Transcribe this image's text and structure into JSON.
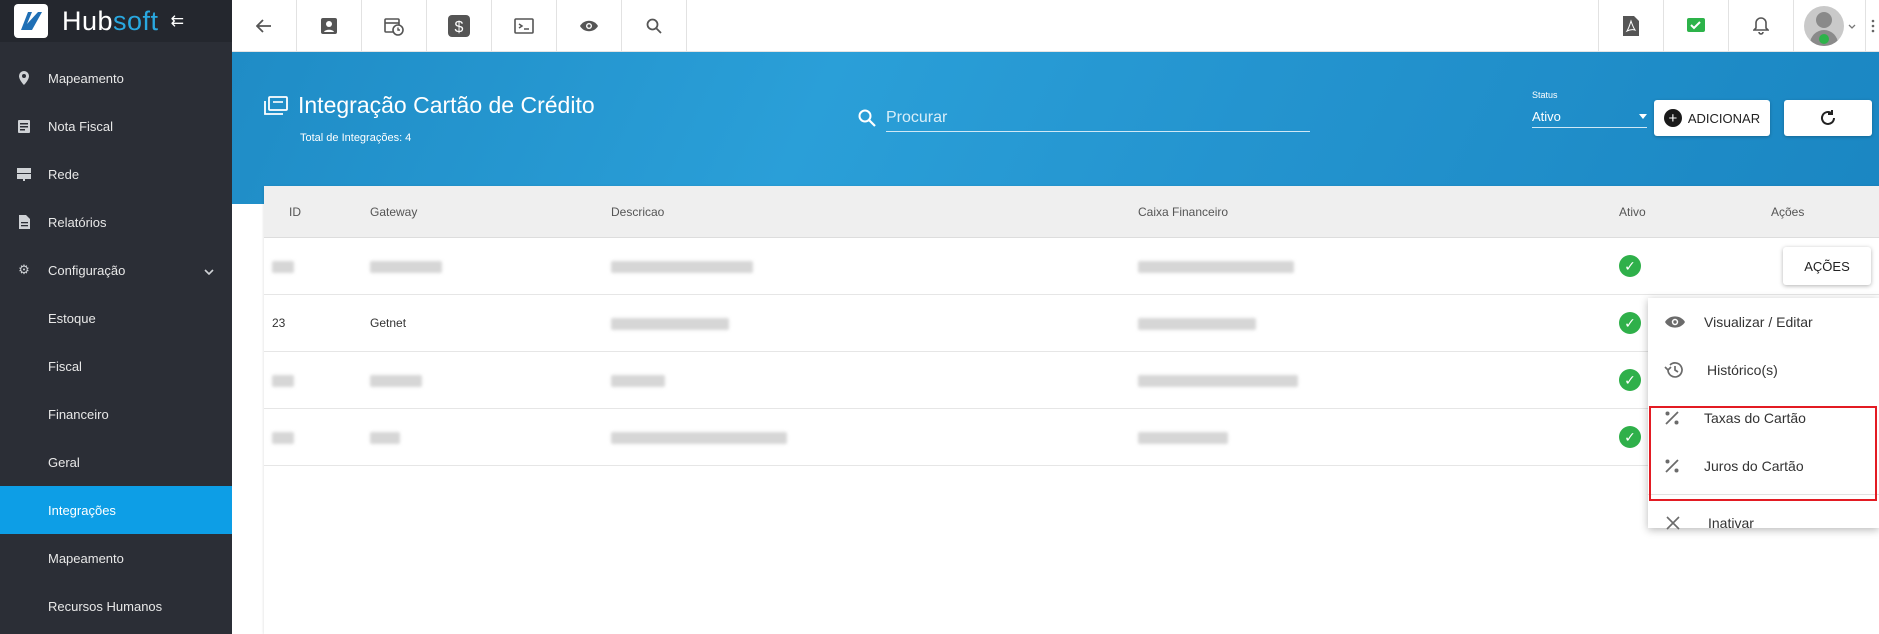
{
  "brand": {
    "name_part1": "Hub",
    "name_part2": "soft"
  },
  "sidebar": {
    "items": [
      {
        "label": "Mapeamento",
        "icon": "map-pin-icon"
      },
      {
        "label": "Nota Fiscal",
        "icon": "receipt-icon"
      },
      {
        "label": "Rede",
        "icon": "server-icon"
      },
      {
        "label": "Relatórios",
        "icon": "document-icon"
      },
      {
        "label": "Configuração",
        "icon": "gear-icon"
      }
    ],
    "subitems": [
      {
        "label": "Estoque"
      },
      {
        "label": "Fiscal"
      },
      {
        "label": "Financeiro"
      },
      {
        "label": "Geral"
      },
      {
        "label": "Integrações",
        "active": true
      },
      {
        "label": "Mapeamento"
      },
      {
        "label": "Recursos Humanos"
      }
    ]
  },
  "header": {
    "title": "Integração Cartão de Crédito",
    "subtitle": "Total de Integrações: 4",
    "search_placeholder": "Procurar",
    "status_label": "Status",
    "status_value": "Ativo",
    "add_label": "ADICIONAR"
  },
  "table": {
    "columns": [
      "ID",
      "Gateway",
      "Descricao",
      "Caixa Financeiro",
      "Ativo",
      "Ações"
    ],
    "rows": [
      {
        "id": "",
        "gateway": "",
        "ativo": true,
        "show_action": true
      },
      {
        "id": "23",
        "gateway": "Getnet",
        "ativo": true,
        "show_action": false
      },
      {
        "id": "",
        "gateway": "",
        "ativo": true,
        "show_action": false
      },
      {
        "id": "",
        "gateway": "",
        "ativo": true,
        "show_action": false
      }
    ],
    "action_label": "AÇÕES"
  },
  "dropdown": {
    "items": [
      {
        "label": "Visualizar / Editar",
        "icon": "eye-icon"
      },
      {
        "label": "Histórico(s)",
        "icon": "history-icon"
      },
      {
        "label": "Taxas do Cartão",
        "icon": "percent-icon"
      },
      {
        "label": "Juros do Cartão",
        "icon": "percent-icon"
      },
      {
        "label": "Inativar",
        "icon": "close-icon"
      }
    ]
  },
  "colors": {
    "sidebar_bg": "#2b2e36",
    "accent": "#0d9ee6",
    "band": "#2a9fd8",
    "success": "#2fb04a",
    "highlight": "#e31b23"
  }
}
